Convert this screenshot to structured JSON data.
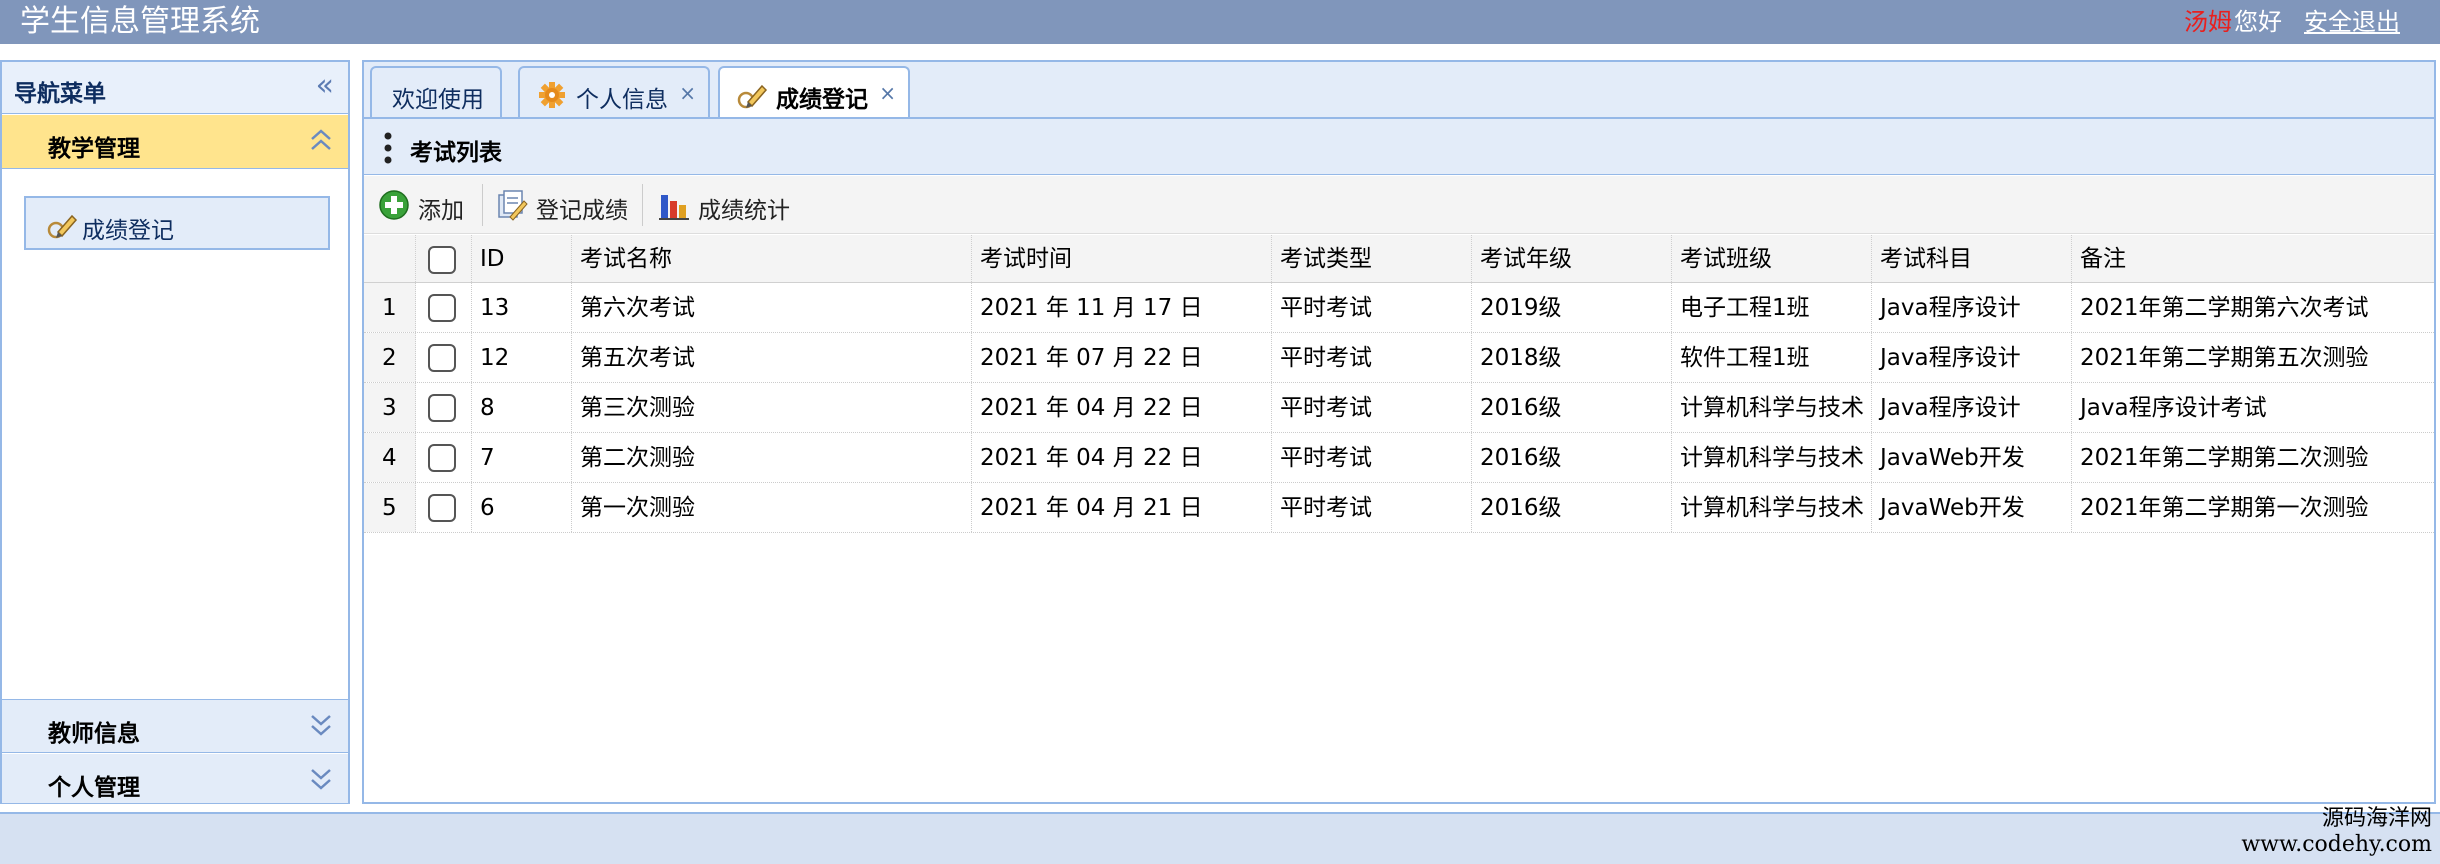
{
  "header": {
    "app_title": "学生信息管理系统",
    "user_name": "汤姆",
    "greeting": "您好",
    "logout_label": "安全退出"
  },
  "nav": {
    "title": "导航菜单",
    "sections": [
      {
        "label": "教学管理",
        "expanded": true,
        "items": [
          {
            "label": "成绩登记",
            "icon": "pencil-icon"
          }
        ]
      },
      {
        "label": "教师信息",
        "expanded": false
      },
      {
        "label": "个人管理",
        "expanded": false
      }
    ]
  },
  "tabs": [
    {
      "label": "欢迎使用",
      "closable": false
    },
    {
      "label": "个人信息",
      "closable": true,
      "icon": "gear-icon"
    },
    {
      "label": "成绩登记",
      "closable": true,
      "icon": "pencil-icon",
      "selected": true
    }
  ],
  "tab_close_glyph": "×",
  "panel": {
    "title": "考试列表"
  },
  "toolbar": {
    "add_label": "添加",
    "register_label": "登记成绩",
    "stats_label": "成绩统计"
  },
  "grid": {
    "columns": [
      "ID",
      "考试名称",
      "考试时间",
      "考试类型",
      "考试年级",
      "考试班级",
      "考试科目",
      "备注"
    ],
    "rows": [
      {
        "num": "1",
        "id": "13",
        "name": "第六次考试",
        "time": "2021 年 11 月 17 日",
        "type": "平时考试",
        "grade": "2019级",
        "class": "电子工程1班",
        "subject": "Java程序设计",
        "remark": "2021年第二学期第六次考试"
      },
      {
        "num": "2",
        "id": "12",
        "name": "第五次考试",
        "time": "2021 年 07 月 22 日",
        "type": "平时考试",
        "grade": "2018级",
        "class": "软件工程1班",
        "subject": "Java程序设计",
        "remark": "2021年第二学期第五次测验"
      },
      {
        "num": "3",
        "id": "8",
        "name": "第三次测验",
        "time": "2021 年 04 月 22 日",
        "type": "平时考试",
        "grade": "2016级",
        "class": "计算机科学与技术",
        "subject": "Java程序设计",
        "remark": "Java程序设计考试"
      },
      {
        "num": "4",
        "id": "7",
        "name": "第二次测验",
        "time": "2021 年 04 月 22 日",
        "type": "平时考试",
        "grade": "2016级",
        "class": "计算机科学与技术",
        "subject": "JavaWeb开发",
        "remark": "2021年第二学期第二次测验"
      },
      {
        "num": "5",
        "id": "6",
        "name": "第一次测验",
        "time": "2021 年 04 月 21 日",
        "type": "平时考试",
        "grade": "2016级",
        "class": "计算机科学与技术",
        "subject": "JavaWeb开发",
        "remark": "2021年第二学期第一次测验"
      }
    ]
  },
  "watermark": {
    "line1": "源码海洋网",
    "line2": "www.codehy.com"
  },
  "colors": {
    "header_bg": "#8096bb",
    "active_section": "#ffe48d",
    "border": "#95b8e7",
    "user_name": "#e8201e"
  }
}
